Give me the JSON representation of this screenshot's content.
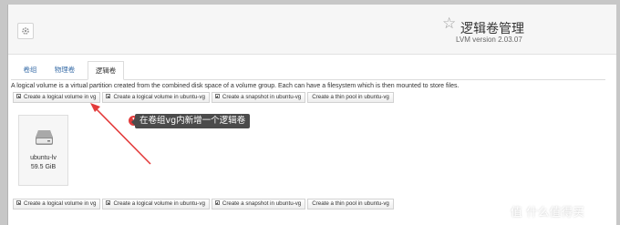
{
  "app": {
    "title": "逻辑卷管理",
    "version": "LVM version 2.03.07"
  },
  "tabs": [
    {
      "label": "卷组",
      "active": false
    },
    {
      "label": "物理卷",
      "active": false
    },
    {
      "label": "逻辑卷",
      "active": true
    }
  ],
  "description": "A logical volume is a virtual partition created from the combined disk space of a volume group. Each can have a filesystem which is then mounted to store files.",
  "actions_top": [
    "Create a logical volume in vg",
    "Create a logical volume in ubuntu-vg",
    "Create a snapshot in ubuntu-vg",
    "Create a thin pool in ubuntu-vg"
  ],
  "actions_bottom": [
    "Create a logical volume in vg",
    "Create a logical volume in ubuntu-vg",
    "Create a snapshot in ubuntu-vg",
    "Create a thin pool in ubuntu-vg"
  ],
  "volumes": [
    {
      "name": "ubuntu-lv",
      "size": "59.5 GiB"
    }
  ],
  "annotation": {
    "number": "1",
    "text": "在卷组vg内新增一个逻辑卷"
  },
  "watermark": "值 什么值得买",
  "colors": {
    "annotation_badge": "#e33b3b",
    "arrow": "#e33b3b",
    "tab_link": "#3a6ea8"
  }
}
